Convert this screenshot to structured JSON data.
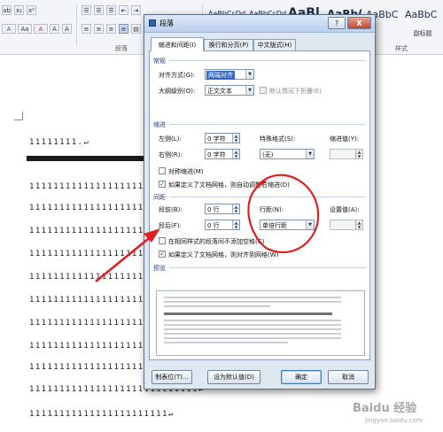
{
  "ribbon": {
    "font_row1_glyphs": [
      "ab",
      "x₂",
      "x²"
    ],
    "font_row2_glyphs": [
      "A",
      "Aa",
      "A",
      "A",
      "A"
    ],
    "para_row1_glyphs": [
      "☰",
      "☰",
      "☰",
      "⇤",
      "⇥",
      "↕",
      "A↓",
      "¶"
    ],
    "para_row2_glyphs": [
      "≡",
      "≡",
      "≡",
      "≡",
      "▤",
      "↕",
      "▦",
      "⊞"
    ],
    "paragraph_group_label": "段落",
    "styles": [
      {
        "sample": "AaBbCcDd",
        "name": ""
      },
      {
        "sample": "AaBbCcDd",
        "name": ""
      },
      {
        "sample": "AaBl",
        "name": ""
      },
      {
        "sample": "AaBb(",
        "name": ""
      },
      {
        "sample": "AaBbC",
        "name": ""
      },
      {
        "sample": "AaBbC",
        "name": "副标题"
      }
    ],
    "styles_group_label": "样式"
  },
  "document": {
    "lines": [
      "11111111.↵",
      "1111111111111111111111111111↵",
      "111111111111111111111111111↵",
      "1111111111111111111111111111↵",
      "1111111111111111111111111111↵",
      "1111111111111111111111111111↵",
      "1111111111111111111111111111↵",
      "1111111111111111111111111111↵",
      "1111111111111111111111111111↵",
      "1111111111111111111111111111↵",
      "1111111111111111111111111111↵",
      "1111111111111111111111111111↵",
      "1111111111111111111111111111↵",
      "1111111111111111111111111111↵",
      "11111111111111111111111↵"
    ]
  },
  "dialog": {
    "title": "段落",
    "help_label": "?",
    "close_label": "X",
    "tabs": [
      {
        "label": "缩进和间距(I)",
        "active": true
      },
      {
        "label": "换行和分页(P)",
        "active": false
      },
      {
        "label": "中文版式(H)",
        "active": false
      }
    ],
    "general": {
      "section_title": "常规",
      "alignment_label": "对齐方式(G):",
      "alignment_value": "两端对齐",
      "outline_label": "大纲级别(O):",
      "outline_value": "正文文本",
      "collapse_label": "默认情况下折叠(E)"
    },
    "indent": {
      "section_title": "缩进",
      "left_label": "左侧(L):",
      "left_value": "0 字符",
      "right_label": "右侧(R):",
      "right_value": "0 字符",
      "special_label": "特殊格式(S):",
      "special_value": "(无)",
      "indent_value_label": "缩进值(Y):",
      "mirror_label": "对称缩进(M)",
      "auto_adjust_label": "如果定义了文档网格，则自动调整右缩进(D)"
    },
    "spacing": {
      "section_title": "间距",
      "before_label": "段前(B):",
      "before_value": "0 行",
      "after_label": "段后(F):",
      "after_value": "0 行",
      "line_label": "行距(N):",
      "line_value": "单倍行距",
      "setting_label": "设置值(A):",
      "no_space_label": "在相同样式的段落间不添加空格(C)",
      "snap_grid_label": "如果定义了文档网格，则对齐到网格(W)"
    },
    "preview": {
      "section_title": "预览"
    },
    "buttons": {
      "tabs": "制表位(T)...",
      "set_default": "设为默认值(D)",
      "ok": "确定",
      "cancel": "取消"
    }
  },
  "annotations": {
    "circle_color": "#e02020",
    "arrow_color": "#e02020"
  },
  "watermark": {
    "logo": "Baidu 经验",
    "url": "jingyan.baidu.com"
  }
}
